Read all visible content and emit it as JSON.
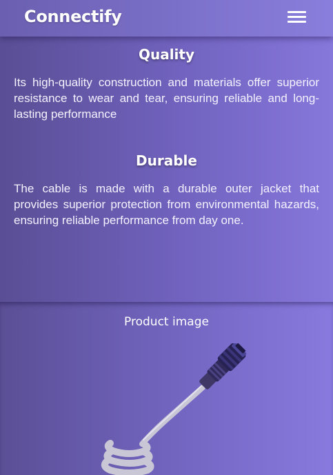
{
  "header": {
    "brand": "Connectify",
    "menu_icon": "hamburger-menu-icon"
  },
  "features": [
    {
      "title": "Quality",
      "text": "Its high-quality construction and materials offer superior resistance to wear and tear, ensuring reliable and long-lasting performance"
    },
    {
      "title": "Durable",
      "text": "The cable is made with a durable outer jacket that provides superior protection from environmental hazards, ensuring reliable performance from day one."
    }
  ],
  "product": {
    "label": "Product image",
    "image_icon": "ethernet-cable-icon"
  },
  "colors": {
    "accent": "#7467c3",
    "header": "#7d72cc",
    "text": "#ffffff"
  }
}
